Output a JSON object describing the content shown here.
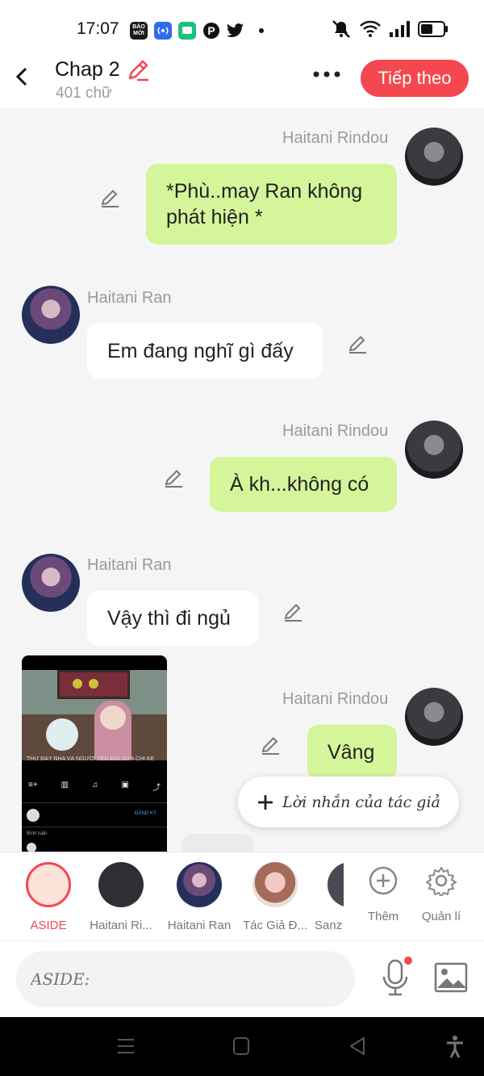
{
  "status_bar": {
    "time": "17:07",
    "apps": [
      {
        "icon": "baomoi-icon",
        "text": "BÁO\nMỚI",
        "color": "#1a1a1a"
      },
      {
        "icon": "broadcast-icon",
        "text": "((•))",
        "color": "#2e6cf0"
      },
      {
        "icon": "chat-app-icon",
        "text": "▣",
        "color": "#19c37d"
      },
      {
        "icon": "pinterest-icon",
        "text": "P",
        "color": "#111"
      },
      {
        "icon": "twitter-icon",
        "text": "t",
        "color": "#111"
      }
    ]
  },
  "header": {
    "title": "Chap 2",
    "subtitle": "401 chữ",
    "next_label": "Tiếp theo",
    "accent": "#f5474f"
  },
  "messages": [
    {
      "sender": "Haitani Rindou",
      "side": "right",
      "text": "*Phù..may Ran không phát hiện *"
    },
    {
      "sender": "Haitani Ran",
      "side": "left",
      "text": "Em đang nghĩ gì đấy"
    },
    {
      "sender": "Haitani Rindou",
      "side": "right",
      "text": "À kh...không có"
    },
    {
      "sender": "Haitani Ran",
      "side": "left",
      "text": "Vậy thì đi ngủ"
    },
    {
      "sender": "Haitani Rindou",
      "side": "right",
      "text": "Vâng"
    }
  ],
  "author_note": {
    "label": "Lời nhắn của tác giả"
  },
  "characters": [
    {
      "label": "ASIDE",
      "active": true
    },
    {
      "label": "Haitani Ri..."
    },
    {
      "label": "Haitani Ran"
    },
    {
      "label": "Tác Giả Đ..."
    },
    {
      "label": "Sanz"
    }
  ],
  "tools": {
    "add_label": "Thêm",
    "manage_label": "Quản lí"
  },
  "input": {
    "placeholder": "ASIDE:"
  },
  "video": {
    "title": "THỬ ĐẤY NHA VÀ NGƯỜI YÊU ĐỐI SỬA CHỈ KẾ",
    "subscribe": "ĐĂNG KÝ",
    "comments": "Bình luận"
  }
}
